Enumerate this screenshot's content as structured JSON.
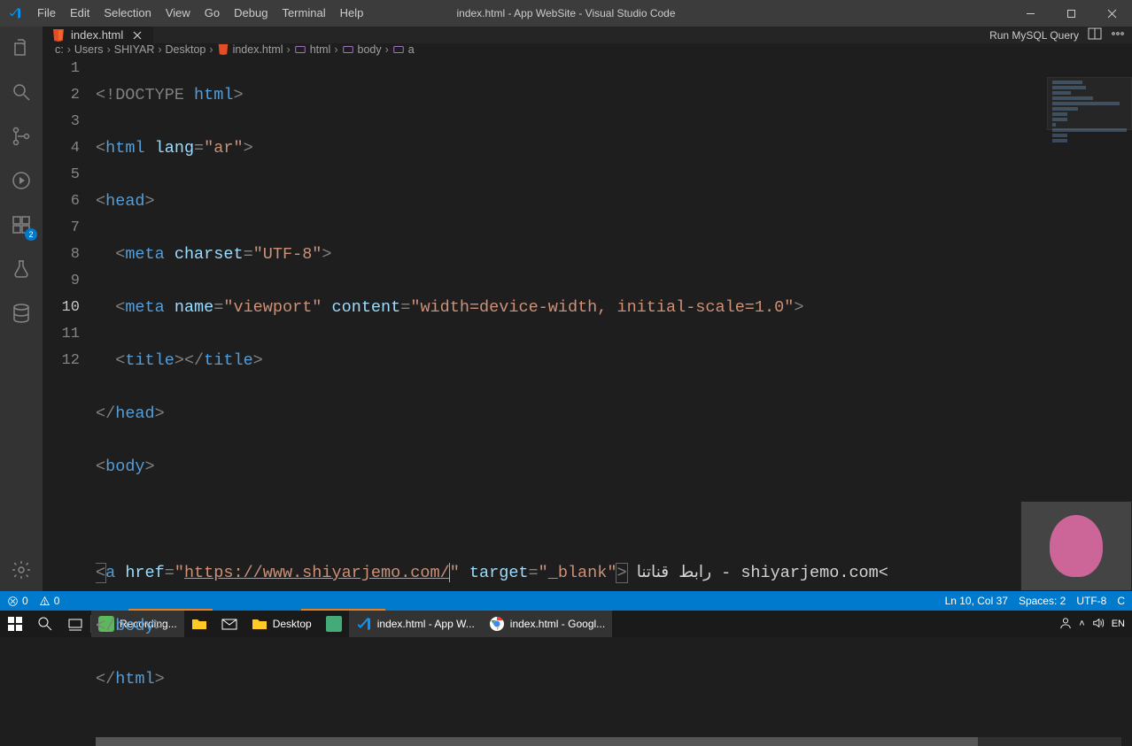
{
  "window": {
    "title": "index.html - App WebSite - Visual Studio Code"
  },
  "menu": {
    "file": "File",
    "edit": "Edit",
    "selection": "Selection",
    "view": "View",
    "go": "Go",
    "debug": "Debug",
    "terminal": "Terminal",
    "help": "Help"
  },
  "activitybar": {
    "explorer": "explorer",
    "search": "search",
    "scm": "source-control",
    "debug": "debug",
    "extensions": "extensions",
    "ext_badge": "2",
    "testing": "testing",
    "database": "database",
    "settings": "settings"
  },
  "tabs": {
    "run_mysql": "Run MySQL Query",
    "active": {
      "label": "index.html"
    }
  },
  "breadcrumbs": {
    "c": "c:",
    "users": "Users",
    "shiyar": "SHIYAR",
    "desktop": "Desktop",
    "file": "index.html",
    "html": "html",
    "body": "body",
    "a": "a"
  },
  "code": {
    "l1_doctype": "<!DOCTYPE",
    "l1_html": " html",
    "l1_close": ">",
    "l2_open": "<",
    "l2_tag": "html",
    "l2_attr": " lang",
    "l2_eq": "=",
    "l2_val": "\"ar\"",
    "l2_close": ">",
    "l3_open": "<",
    "l3_tag": "head",
    "l3_close": ">",
    "l4_indent": "  ",
    "l4_open": "<",
    "l4_tag": "meta",
    "l4_attr": " charset",
    "l4_eq": "=",
    "l4_val": "\"UTF-8\"",
    "l4_close": ">",
    "l5_indent": "  ",
    "l5_open": "<",
    "l5_tag": "meta",
    "l5_attr1": " name",
    "l5_eq1": "=",
    "l5_val1": "\"viewport\"",
    "l5_attr2": " content",
    "l5_eq2": "=",
    "l5_val2": "\"width=device-width, initial-scale=1.0\"",
    "l5_close": ">",
    "l6_indent": "  ",
    "l6_open": "<",
    "l6_tag": "title",
    "l6_mid": "></",
    "l6_tag2": "title",
    "l6_close": ">",
    "l7_open": "</",
    "l7_tag": "head",
    "l7_close": ">",
    "l8_open": "<",
    "l8_tag": "body",
    "l8_close": ">",
    "l10_open": "<",
    "l10_tag": "a",
    "l10_attr1": " href",
    "l10_eq1": "=",
    "l10_q1": "\"",
    "l10_url": "https://www.shiyarjemo.com/",
    "l10_q2": "\"",
    "l10_attr2": " target",
    "l10_eq2": "=",
    "l10_val2": "\"_blank\"",
    "l10_close": ">",
    "l10_text": " رابط قناتنا - shiyarjemo.com<",
    "l11_open": "</",
    "l11_tag": "body",
    "l11_close": ">",
    "l12_open": "</",
    "l12_tag": "html",
    "l12_close": ">"
  },
  "line_numbers": [
    "1",
    "2",
    "3",
    "4",
    "5",
    "6",
    "7",
    "8",
    "9",
    "10",
    "11",
    "12"
  ],
  "status": {
    "errors": "0",
    "warnings": "0",
    "ln_col": "Ln 10, Col 37",
    "spaces": "Spaces: 2",
    "encoding": "UTF-8",
    "eol": "C"
  },
  "taskbar": {
    "recording": "Recording...",
    "desktop": "Desktop",
    "vscode": "index.html - App W...",
    "chrome": "index.html - Googl..."
  },
  "tray": {
    "lang": "EN"
  }
}
